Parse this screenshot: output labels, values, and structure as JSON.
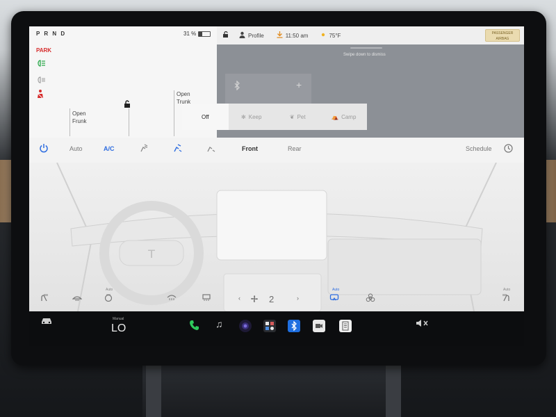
{
  "status": {
    "gear": "P R N D",
    "battery_percent": "31 %",
    "battery_level": 0.31,
    "telltales": [
      {
        "icon": "park-brake-icon",
        "text": "PARK",
        "color": "#d62b2b"
      },
      {
        "icon": "headlights-icon",
        "color": "#2aa84a"
      },
      {
        "icon": "high-beam-icon",
        "color": "#9a9a9a"
      },
      {
        "icon": "seatbelt-icon",
        "color": "#d62b2b"
      }
    ],
    "frunk_label": "Open\nFrunk",
    "trunk_label": "Open\nTrunk"
  },
  "topbar": {
    "profile": "Profile",
    "time": "11:50 am",
    "temperature": "75°F",
    "airbag_badge": "PASSENGER AIRBAG"
  },
  "overlay": {
    "dismiss_hint": "Swipe down to dismiss"
  },
  "climate_mode": {
    "options": [
      "Off",
      "Keep",
      "Pet",
      "Camp"
    ],
    "selected": "Off"
  },
  "climate_controls": {
    "auto_label": "Auto",
    "ac_label": "A/C",
    "front_label": "Front",
    "rear_label": "Rear",
    "schedule_label": "Schedule"
  },
  "fan": {
    "speed": "2"
  },
  "dock": {
    "temp_mode_label": "Manual",
    "cabin_temp": "LO"
  },
  "colors": {
    "accent_blue": "#2e6de0",
    "phone_green": "#2ec95c",
    "warning_red": "#d62b2b"
  }
}
